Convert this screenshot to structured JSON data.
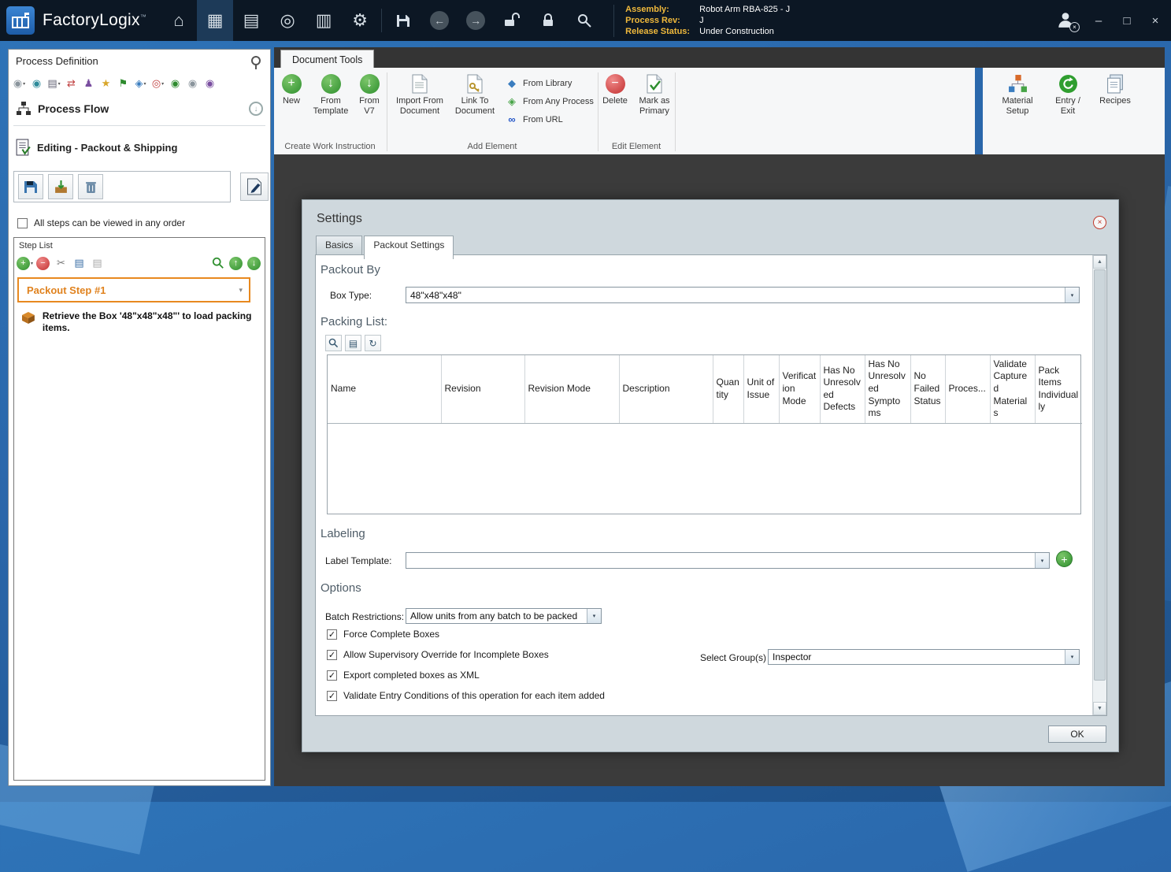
{
  "titlebar": {
    "app_name": "FactoryLogix",
    "tm": "™",
    "assembly_label": "Assembly:",
    "assembly_value": "Robot Arm RBA-825 - J",
    "process_rev_label": "Process Rev:",
    "process_rev_value": "J",
    "release_status_label": "Release Status:",
    "release_status_value": "Under Construction",
    "minimize": "–",
    "maximize": "□",
    "close": "×"
  },
  "icons": {
    "home": "⌂",
    "work_instructions": "▦",
    "process_documents": "▤",
    "navigator": "◎",
    "reports": "▥",
    "gear": "⚙",
    "back": "←",
    "forward": "→",
    "plus": "+",
    "minus": "−",
    "down": "↓",
    "up": "↑",
    "check": "✓",
    "x": "×",
    "caret": "▾",
    "scroll_up": "▲",
    "scroll_down": "▼",
    "scissors": "✂",
    "copy": "▤",
    "paste": "▤",
    "pencil": "✎",
    "star": "★",
    "flag": "⚑",
    "person": "♟",
    "transfer": "⇄",
    "undo": "↺",
    "circle": "◉",
    "print": "▤",
    "process": "◈",
    "target": "◎",
    "link": "∞",
    "library": "◆",
    "list": "▤",
    "refresh": "↻"
  },
  "sidebar": {
    "title": "Process Definition",
    "process_flow_label": "Process Flow",
    "editing_label": "Editing - Packout & Shipping",
    "order_checkbox_label": "All steps can be viewed in any order",
    "step_list_title": "Step List",
    "step_title": "Packout Step #1",
    "step_description": "Retrieve the Box '48\"x48\"x48\"' to load packing items."
  },
  "ribbon": {
    "tab_label": "Document Tools",
    "create_group_label": "Create Work Instruction",
    "new_label": "New",
    "from_template_label": "From Template",
    "from_v7_label": "From V7",
    "add_group_label": "Add Element",
    "import_label": "Import From Document",
    "link_label": "Link To Document",
    "from_library_label": "From Library",
    "from_any_process_label": "From Any Process",
    "from_url_label": "From URL",
    "edit_group_label": "Edit Element",
    "delete_label": "Delete",
    "mark_primary_label": "Mark as Primary",
    "material_setup_label": "Material Setup",
    "entry_exit_label": "Entry / Exit",
    "recipes_label": "Recipes"
  },
  "dialog": {
    "title": "Settings",
    "tabs": {
      "basics": "Basics",
      "packout": "Packout Settings"
    },
    "packout_by_heading": "Packout By",
    "box_type_label": "Box Type:",
    "box_type_value": "48\"x48\"x48\"",
    "packing_list_heading": "Packing List:",
    "columns": [
      "Name",
      "Revision",
      "Revision Mode",
      "Description",
      "Quantity",
      "Unit of Issue",
      "Verification Mode",
      "Has No Unresolved Defects",
      "Has No Unresolved Symptoms",
      "No Failed Status",
      "Proces...",
      "Validate Captured Materials",
      "Pack Items Individually"
    ],
    "labeling_heading": "Labeling",
    "label_template_label": "Label Template:",
    "label_template_value": "",
    "options_heading": "Options",
    "batch_label": "Batch Restrictions:",
    "batch_value": "Allow units from any batch to be packed",
    "checkboxes": [
      "Force Complete Boxes",
      "Allow Supervisory Override for Incomplete Boxes",
      "Export completed boxes as XML",
      "Validate Entry Conditions of this operation for each item added"
    ],
    "select_group_label": "Select Group(s)",
    "select_group_value": "Inspector",
    "ok_label": "OK"
  }
}
